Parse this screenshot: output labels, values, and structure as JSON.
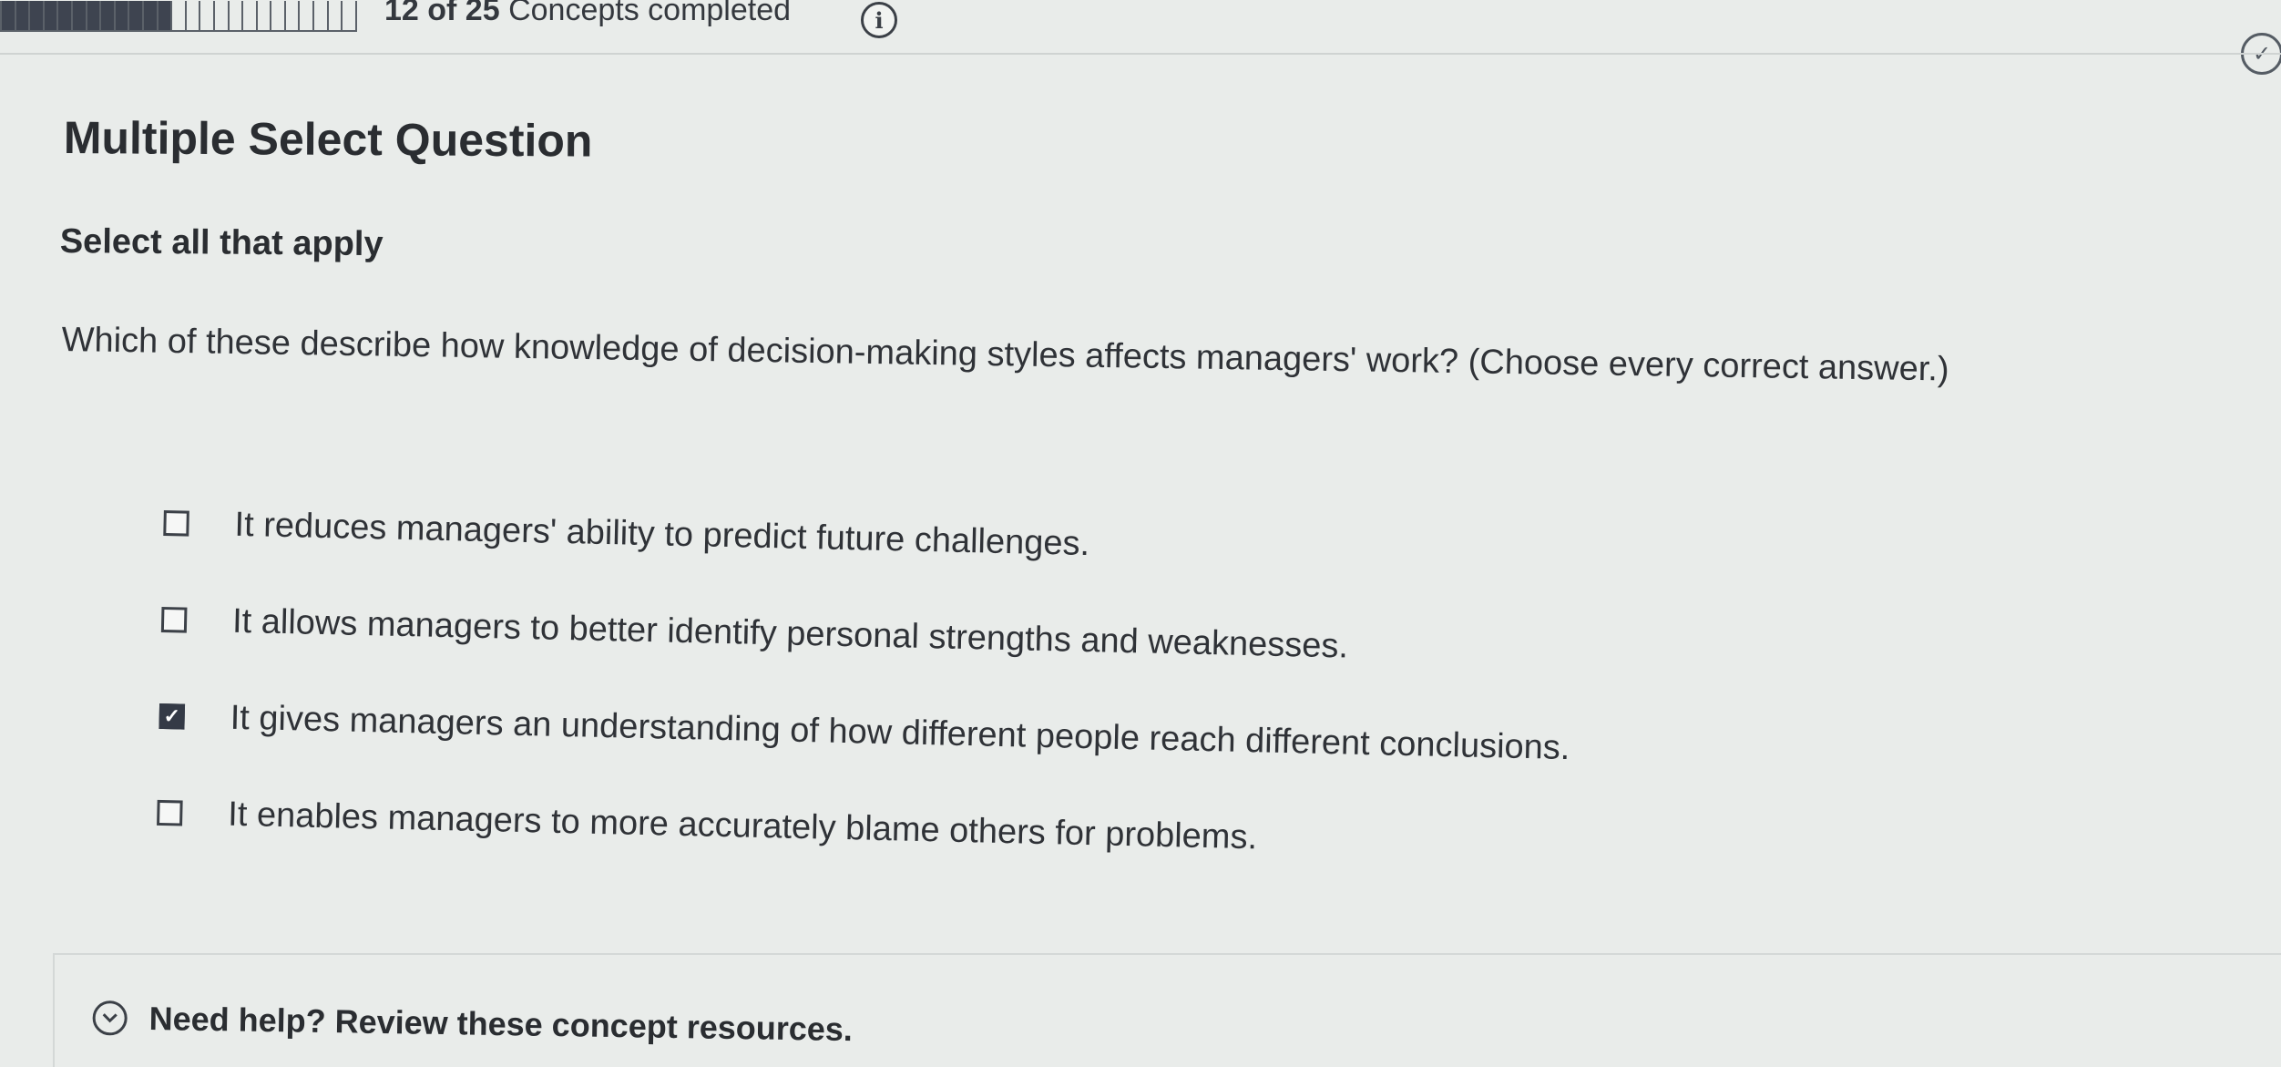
{
  "progress": {
    "completed": 12,
    "total": 25,
    "fraction": 0.48,
    "count_text": "12 of 25",
    "label": "Concepts completed",
    "info_icon": "info-icon"
  },
  "status_icon": "check-circle-icon",
  "question": {
    "type_label": "Multiple Select Question",
    "instruction": "Select all that apply",
    "prompt": "Which of these describe how knowledge of decision-making styles affects managers' work? (Choose every correct answer.)",
    "options": [
      {
        "label": "It reduces managers' ability to predict future challenges.",
        "checked": false
      },
      {
        "label": "It allows managers to better identify personal strengths and weaknesses.",
        "checked": false
      },
      {
        "label": "It gives managers an understanding of how different people reach different conclusions.",
        "checked": true
      },
      {
        "label": "It enables managers to more accurately blame others for problems.",
        "checked": false
      }
    ]
  },
  "help": {
    "label": "Need help? Review these concept resources.",
    "icon": "chevron-down-icon"
  },
  "colors": {
    "background": "#e9ecea",
    "progress_fill": "#3e4450",
    "checkbox_checked": "#343a46",
    "text": "#2a2d31"
  }
}
